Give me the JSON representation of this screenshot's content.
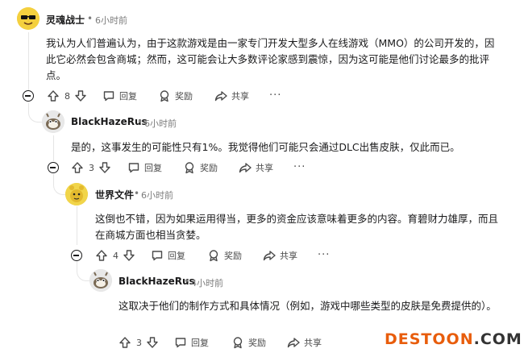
{
  "comments": [
    {
      "username": "灵魂战士",
      "time": "6小时前",
      "body": "我认为人们普遍认为，由于这款游戏是由一家专门开发大型多人在线游戏（MMO）的公司开发的，因此它必然会包含商城；然而，这可能会让大多数评论家感到震惊，因为这可能是他们讨论最多的批评点。",
      "votes": "8",
      "reply": "回复",
      "award": "奖励",
      "share": "共享",
      "more": "···"
    },
    {
      "username": "BlackHazeRus",
      "time": "6小时前",
      "body": "是的，这事发生的可能性只有1%。我觉得他们可能只会通过DLC出售皮肤，仅此而已。",
      "votes": "3",
      "reply": "回复",
      "award": "奖励",
      "share": "共享",
      "more": "···"
    },
    {
      "username": "世界文件",
      "time": "6小时前",
      "body": "这倒也不错，因为如果运用得当，更多的资金应该意味着更多的内容。育碧财力雄厚，而且在商城方面也相当贪婪。",
      "votes": "4",
      "reply": "回复",
      "award": "奖励",
      "share": "共享",
      "more": "···"
    },
    {
      "username": "BlackHazeRus",
      "time": "4小时前",
      "body": "这取决于他们的制作方式和具体情况（例如，游戏中哪些类型的皮肤是免费提供的）。",
      "votes": "3",
      "reply": "回复",
      "award": "奖励",
      "share": "共享"
    }
  ],
  "separator": "•",
  "watermark": {
    "part1": "DESTOON",
    "part2": ".COM",
    "color1": "#e85d0c",
    "color2": "#333333"
  }
}
